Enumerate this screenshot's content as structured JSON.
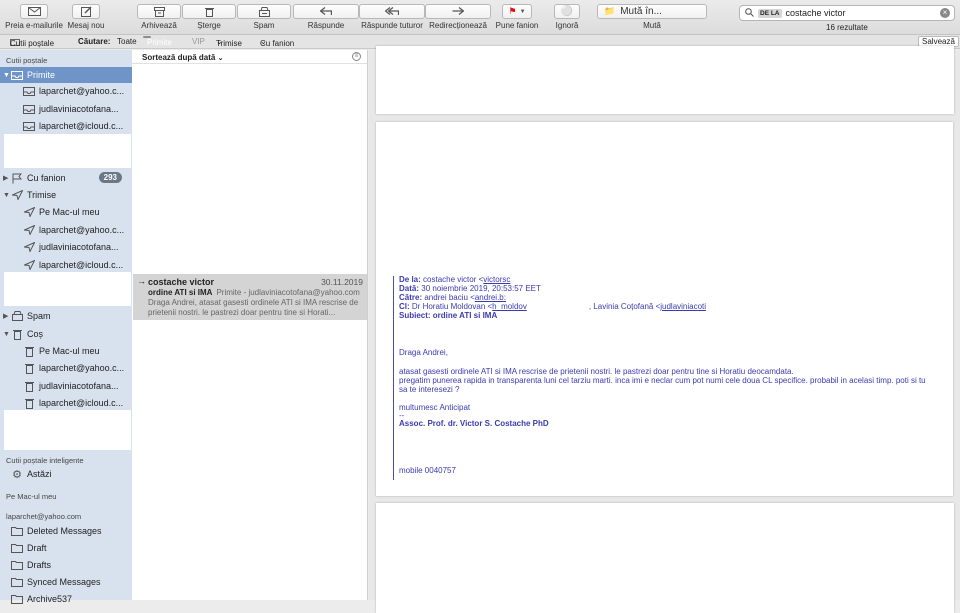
{
  "toolbar": {
    "get_mail": "Preia e-mailurile",
    "new_message": "Mesaj nou",
    "archive": "Arhivează",
    "delete": "Șterge",
    "spam": "Spam",
    "reply": "Răspunde",
    "reply_all": "Răspunde tuturor",
    "forward": "Redirecționează",
    "flag": "Pune fanion",
    "ignore": "Ignoră",
    "move_to": "Mută în...",
    "move": "Mută",
    "search_token": "DE LA",
    "search_value": "costache victor",
    "results": "16 rezultate"
  },
  "filterbar": {
    "mailboxes": "Cutii poștale",
    "search_label": "Căutare:",
    "all": "Toate",
    "inbox": "Primite",
    "vip": "VIP",
    "sent": "Trimise",
    "flagged": "Cu fanion",
    "save": "Salvează"
  },
  "sidebar": {
    "section_mailboxes": "Cutii poștale",
    "inbox": "Primite",
    "inbox_accounts": [
      "laparchet@yahoo.c...",
      "judlaviniacotofana...",
      "laparchet@icloud.c..."
    ],
    "flagged": "Cu fanion",
    "flagged_count": "293",
    "sent": "Trimise",
    "sent_accounts": [
      "Pe Mac-ul meu",
      "laparchet@yahoo.c...",
      "judlaviniacotofana...",
      "laparchet@icloud.c..."
    ],
    "spam": "Spam",
    "trash": "Coș",
    "trash_accounts": [
      "Pe Mac-ul meu",
      "laparchet@yahoo.c...",
      "judlaviniacotofana...",
      "laparchet@icloud.c..."
    ],
    "section_smart": "Cutii poștale inteligente",
    "today": "Astăzi",
    "section_mac": "Pe Mac-ul meu",
    "section_yahoo": "laparchet@yahoo.com",
    "yahoo_folders": [
      "Deleted Messages",
      "Draft",
      "Drafts",
      "Synced Messages",
      "Archive537"
    ]
  },
  "list": {
    "sort_label": "Sortează după dată",
    "message": {
      "sender": "costache victor",
      "date": "30.11.2019",
      "subject": "ordine ATI si IMA",
      "location": "Primite - judlaviniacotofana@yahoo.com",
      "preview": "Draga Andrei, atasat gasesti ordinele ATI si IMA rescrise de prietenii nostri. le pastrezi doar pentru tine si Horati..."
    }
  },
  "email": {
    "from_label": "De la:",
    "from_value": "costache victor <",
    "from_email": "victorsc",
    "date_label": "Dată:",
    "date_value": "30 noiembrie 2019, 20:53:57 EET",
    "to_label": "Către:",
    "to_value": "andrei baciu <",
    "to_email": "andrei.b:",
    "cc_label": "Cl:",
    "cc_value": "Dr Horatiu Moldovan <",
    "cc_email": "h_moldov",
    "cc_value2": ", Lavinia Coțofană <",
    "cc_email2": "judlaviniacoti",
    "subject_label": "Subiect:",
    "subject_value": "ordine ATI si IMA",
    "greeting": "Draga Andrei,",
    "body1": "atasat gasesti ordinele ATI si IMA rescrise de prietenii nostri. le pastrezi doar pentru tine si Horatiu deocamdata.",
    "body2": "pregatim punerea rapida in transparenta luni cel tarziu marti. inca imi e neclar cum pot numi cele doua CL specifice. probabil in acelasi timp. poti si tu sa te interesezi ?",
    "thanks": "multumesc Anticipat",
    "sep": "--",
    "signature": "Assoc. Prof. dr. Victor S. Costache PhD",
    "mobile": "mobile 0040757"
  }
}
